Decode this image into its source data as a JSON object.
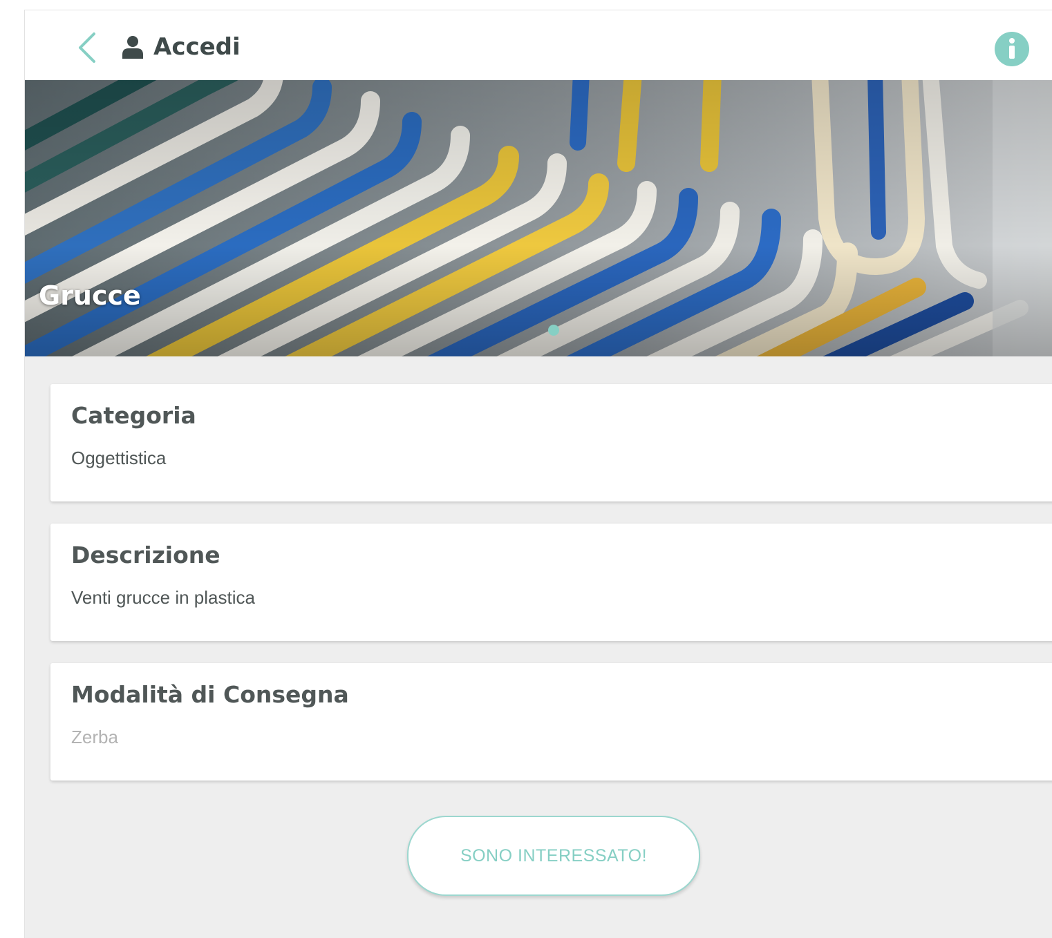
{
  "header": {
    "login_label": "Accedi",
    "accent_color": "#86cfc4",
    "icons": {
      "back": "chevron-left-icon",
      "user": "user-icon",
      "info": "info-icon"
    }
  },
  "hero": {
    "title": "Grucce",
    "slides_total": 1,
    "active_slide": 1
  },
  "details": [
    {
      "title": "Categoria",
      "value": "Oggettistica"
    },
    {
      "title": "Descrizione",
      "value": "Venti grucce in plastica"
    },
    {
      "title": "Modalità di Consegna",
      "value": "Zerba"
    }
  ],
  "cta": {
    "label": "SONO INTERESSATO!"
  }
}
